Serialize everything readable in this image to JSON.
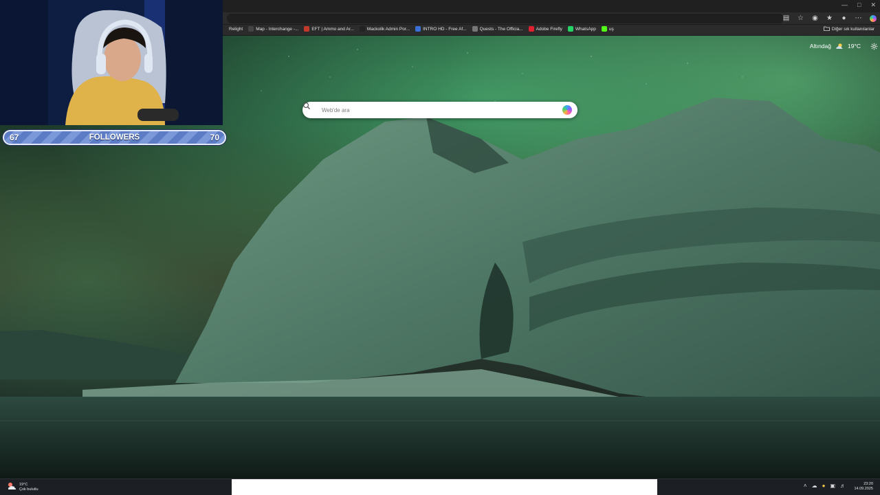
{
  "browser": {
    "bookmarks": [
      {
        "label": "Relight",
        "icon": "relight-favicon",
        "color": "#2b2b2b"
      },
      {
        "label": "Map - Interchange -...",
        "icon": "tarkov-map-favicon",
        "color": "#444444"
      },
      {
        "label": "EFT | Ammo and Ar...",
        "icon": "eft-favicon",
        "color": "#c0392b"
      },
      {
        "label": "Mackolik Admin Por...",
        "icon": "mackolik-favicon",
        "color": "#222222"
      },
      {
        "label": "INTRO HD - Free Af...",
        "icon": "intro-favicon",
        "color": "#3a6fd8"
      },
      {
        "label": "Quests - The Officia...",
        "icon": "wiki-favicon",
        "color": "#777777"
      },
      {
        "label": "Adobe Firefly",
        "icon": "adobe-firefly-favicon",
        "color": "#e0202e"
      },
      {
        "label": "WhatsApp",
        "icon": "whatsapp-favicon",
        "color": "#25d366"
      },
      {
        "label": "uş",
        "icon": "kick-favicon",
        "color": "#53fc18"
      }
    ],
    "other_bookmarks_label": "Diğer sık kullanılanlar"
  },
  "newtab": {
    "weather": {
      "location": "Altındağ",
      "temp": "19°C"
    },
    "search_placeholder": "Web'de ara"
  },
  "stream_overlay": {
    "followers_current": "67",
    "followers_label": "FOLLOWERS",
    "followers_goal": "70"
  },
  "taskbar": {
    "weather_temp": "19°C",
    "weather_desc": "Çok bulutlu",
    "time": "23:20",
    "date": "14.09.2025"
  },
  "colors": {
    "accent_follow_bar": "#6b8ad0",
    "scene_green": "#2f5a44"
  }
}
